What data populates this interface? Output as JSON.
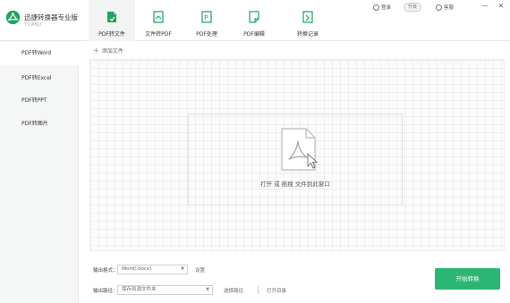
{
  "app": {
    "name": "迅捷转换器专业版",
    "sub": "YUANJI"
  },
  "nav_tabs": [
    {
      "label": "PDF转文件",
      "icon": "pdf-to-file-icon"
    },
    {
      "label": "文件转PDF",
      "icon": "file-to-pdf-icon"
    },
    {
      "label": "PDF处理",
      "icon": "pdf-process-icon"
    },
    {
      "label": "PDF编辑",
      "icon": "pdf-edit-icon"
    },
    {
      "label": "转换记录",
      "icon": "history-icon"
    }
  ],
  "top_bar": {
    "login": "登录",
    "plain_label": "升级",
    "help": "客服",
    "minimize": "—",
    "close": "✕"
  },
  "sidebar": {
    "items": [
      {
        "label": "PDF转Word"
      },
      {
        "label": "PDF转Excel"
      },
      {
        "label": "PDF转PPT"
      },
      {
        "label": "PDF转图片"
      }
    ]
  },
  "main": {
    "add_file": "添加文件",
    "drop_text": "打开 或 拖拽 文件到此窗口"
  },
  "footer": {
    "format_label": "输出格式：",
    "format_value": "Word(.docx)",
    "settings": "设置",
    "path_label": "输出路径：",
    "path_value": "保存到源文件夹",
    "choose_path": "选择路径",
    "open_dir": "打开目录",
    "start": "开始转换"
  },
  "colors": {
    "accent": "#2bb673",
    "pdf_red": "#e53935"
  }
}
